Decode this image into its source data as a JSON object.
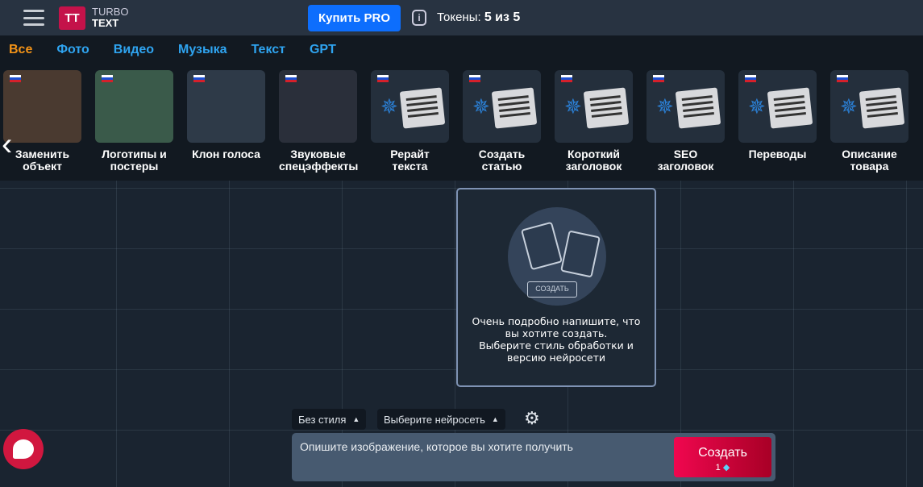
{
  "header": {
    "logo_mark": "TT",
    "logo_line1": "TURBO",
    "logo_line2": "TEXT",
    "buy_pro": "Купить PRO",
    "info_icon": "i",
    "tokens_label": "Токены:",
    "tokens_value": "5 из 5"
  },
  "tabs": [
    "Все",
    "Фото",
    "Видео",
    "Музыка",
    "Текст",
    "GPT"
  ],
  "cards": [
    {
      "line1": "Заменить",
      "line2": "объект"
    },
    {
      "line1": "Логотипы и",
      "line2": "постеры"
    },
    {
      "line1": "Клон голоса",
      "line2": ""
    },
    {
      "line1": "Звуковые",
      "line2": "спецэффекты"
    },
    {
      "line1": "Рерайт",
      "line2": "текста"
    },
    {
      "line1": "Создать",
      "line2": "статью"
    },
    {
      "line1": "Короткий",
      "line2": "заголовок"
    },
    {
      "line1": "SEO",
      "line2": "заголовок"
    },
    {
      "line1": "Переводы",
      "line2": ""
    },
    {
      "line1": "Описание",
      "line2": "товара"
    }
  ],
  "panel": {
    "mini_button": "СОЗДАТЬ",
    "line1": "Очень подробно напишите, что",
    "line2": "вы хотите создать.",
    "line3": "Выберите стиль обработки и",
    "line4": "версию нейросети"
  },
  "controls": {
    "style": "Без стиля",
    "model": "Выберите нейросеть",
    "placeholder": "Опишите изображение, которое вы хотите получить",
    "create": "Создать",
    "cost": "1"
  },
  "colors": {
    "accent": "#0d6efd",
    "active_tab": "#f39317",
    "tab": "#2fa4f0",
    "create": "#e0073f"
  }
}
